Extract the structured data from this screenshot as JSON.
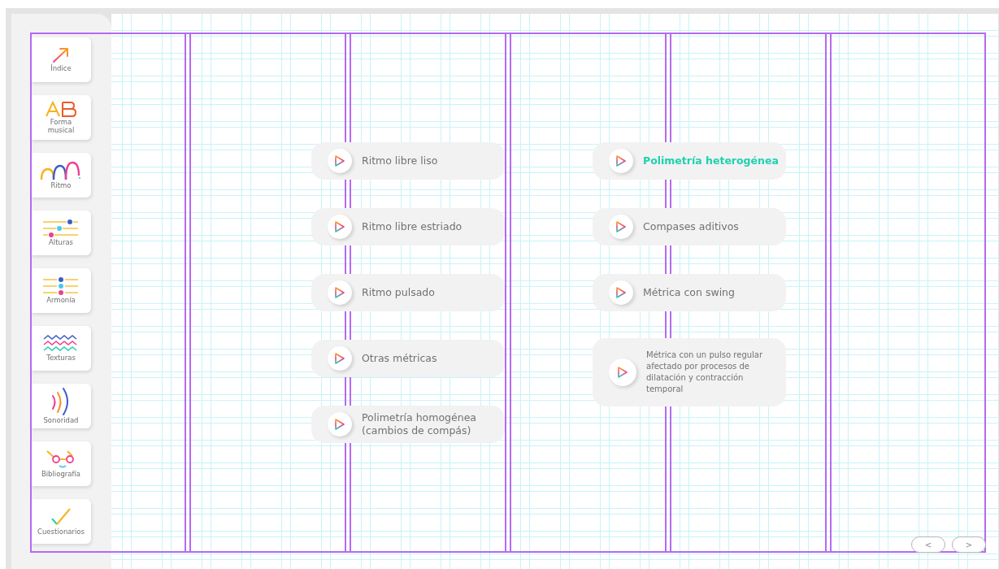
{
  "sidebar": {
    "items": [
      {
        "label": "Índice",
        "kind": "arrow"
      },
      {
        "label": "Forma musical",
        "kind": "letters"
      },
      {
        "label": "Ritmo",
        "kind": "arcs"
      },
      {
        "label": "Alturas",
        "kind": "sliders"
      },
      {
        "label": "Armonía",
        "kind": "chord"
      },
      {
        "label": "Texturas",
        "kind": "waves"
      },
      {
        "label": "Sonoridad",
        "kind": "sound"
      },
      {
        "label": "Bibliografía",
        "kind": "glasses"
      },
      {
        "label": "Cuestionarios",
        "kind": "check"
      }
    ]
  },
  "topics": {
    "columns": [
      [
        {
          "label": "Ritmo libre liso",
          "selected": false
        },
        {
          "label": "Ritmo libre estriado",
          "selected": false
        },
        {
          "label": "Ritmo pulsado",
          "selected": false
        },
        {
          "label": "Otras métricas",
          "selected": false
        },
        {
          "label": "Polimetría homogénea (cambios de compás)",
          "selected": false
        }
      ],
      [
        {
          "label": "Polimetría heterogénea",
          "selected": true
        },
        {
          "label": "Compases aditivos",
          "selected": false
        },
        {
          "label": "Métrica con swing",
          "selected": false
        },
        {
          "label": "Métrica con un pulso regular afectado por procesos de dilatación y contracción temporal",
          "selected": false,
          "kind": "long"
        }
      ]
    ]
  },
  "pager": [
    "<",
    ">"
  ]
}
